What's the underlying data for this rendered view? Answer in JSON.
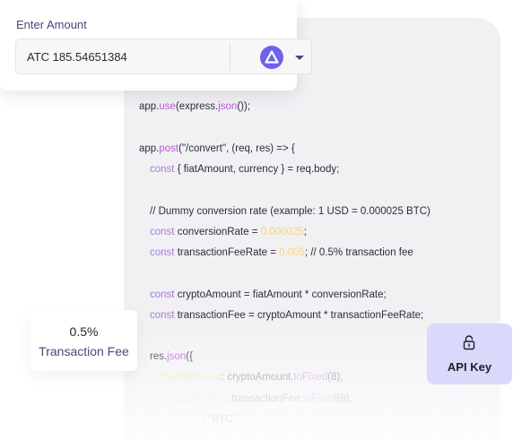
{
  "amount": {
    "label": "Enter Amount",
    "value": "ATC 185.54651384",
    "token_icon": "delta-triangle-icon",
    "dropdown_icon": "caret-down-icon"
  },
  "code": {
    "l1_obj": "app.",
    "l1_fn": "use",
    "l1_mid": "(express.",
    "l1_fn2": "json",
    "l1_end": "());",
    "l2_obj": "app.",
    "l2_fn": "post",
    "l2_rest": "(\"/convert\", (req, res) => {",
    "l3_kw": "const",
    "l3_rest": " { fiatAmount, currency } = req.body;",
    "l4": "// Dummy conversion rate (example: 1 USD = 0.000025 BTC)",
    "l5_kw": "const",
    "l5_mid": " conversionRate = ",
    "l5_num": "0.000025",
    "l5_end": ";",
    "l6_kw": "const",
    "l6_mid": " transactionFeeRate = ",
    "l6_num": "0.005",
    "l6_end": "; // 0.5% transaction fee",
    "l7_kw": "const",
    "l7_rest": " cryptoAmount = fiatAmount * conversionRate;",
    "l8_kw": "const",
    "l8_rest": " transactionFee = cryptoAmount * transactionFeeRate;",
    "l9_obj": "res.",
    "l9_fn": "json",
    "l9_end": "({",
    "l10_key": "cryptoAmount",
    "l10_mid": ": cryptoAmount.",
    "l10_fn": "toFixed",
    "l10_end": "(8),",
    "l11_key": "transactionFee",
    "l11_mid": ": transactionFee.",
    "l11_fn": "toFixed",
    "l11_end": "(8),",
    "l12": ": \"BTC\""
  },
  "fee": {
    "value": "0.5%",
    "label": "Transaction Fee"
  },
  "api": {
    "label": "API Key",
    "icon": "lock-icon"
  },
  "colors": {
    "accent": "#6c63e8",
    "api_card_bg": "#dad9fb",
    "keyword": "#a77bd6",
    "number": "#f6d479"
  }
}
